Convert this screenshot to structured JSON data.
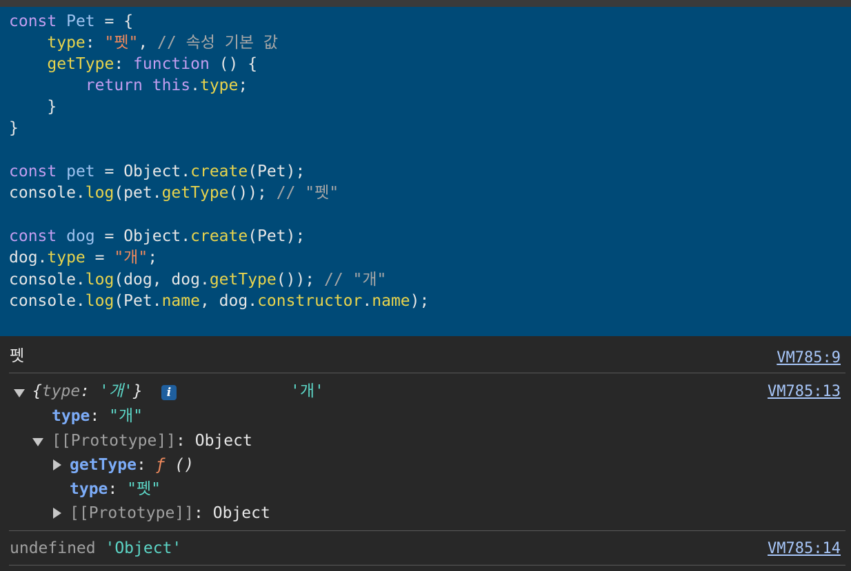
{
  "code": {
    "l1": {
      "kw": "const",
      "name": "Pet",
      "rest": " = {"
    },
    "l2": {
      "indent": "    ",
      "key": "type",
      "colon": ": ",
      "str": "\"펫\"",
      "comma": ", ",
      "comment": "// 속성 기본 값"
    },
    "l3": {
      "indent": "    ",
      "key": "getType",
      "colon": ": ",
      "kw": "function",
      "rest": " () {"
    },
    "l4": {
      "indent": "        ",
      "kw1": "return",
      "sp": " ",
      "kw2": "this",
      "dot": ".",
      "prop": "type",
      "semi": ";"
    },
    "l5": {
      "text": "    }"
    },
    "l6": {
      "text": "}"
    },
    "l8": {
      "kw": "const",
      "name": "pet",
      "eq": " = Object.",
      "fn": "create",
      "rest": "(Pet);"
    },
    "l9": {
      "a": "console.",
      "fn1": "log",
      "b": "(pet.",
      "fn2": "getType",
      "c": "()); ",
      "comment": "// \"펫\""
    },
    "l11": {
      "kw": "const",
      "name": "dog",
      "eq": " = Object.",
      "fn": "create",
      "rest": "(Pet);"
    },
    "l12": {
      "a": "dog.",
      "prop": "type",
      "b": " = ",
      "str": "\"개\"",
      "c": ";"
    },
    "l13": {
      "a": "console.",
      "fn1": "log",
      "b": "(dog, dog.",
      "fn2": "getType",
      "c": "()); ",
      "comment": "// \"개\""
    },
    "l14": {
      "a": "console.",
      "fn1": "log",
      "b": "(Pet.",
      "p1": "name",
      "c": ", dog.",
      "p2": "constructor",
      "d": ".",
      "p3": "name",
      "e": ");"
    }
  },
  "console": {
    "row1": {
      "text": "펫",
      "source": "VM785:9"
    },
    "row2": {
      "open": "{",
      "key": "type",
      "colon": ": ",
      "val": "'개'",
      "close": "}",
      "badge": "i",
      "second": "'개'",
      "source": "VM785:13",
      "prop_key": "type",
      "prop_colon": ": ",
      "prop_val": "\"개\"",
      "proto_label": "[[Prototype]]",
      "proto_colon": ": ",
      "proto_type": "Object",
      "gt_key": "getType",
      "gt_colon": ": ",
      "gt_f": "ƒ",
      "gt_args": " ()",
      "ptype_key": "type",
      "ptype_colon": ": ",
      "ptype_val": "\"펫\"",
      "proto2_label": "[[Prototype]]",
      "proto2_colon": ": ",
      "proto2_type": "Object"
    },
    "row3": {
      "undef": "undefined",
      "val": "'Object'",
      "source": "VM785:14"
    }
  },
  "colors": {
    "editor_bg": "#004a77",
    "console_bg": "#282828",
    "link": "#a8c7fa",
    "string_val": "#5cd5c6",
    "key": "#7cacf8"
  }
}
